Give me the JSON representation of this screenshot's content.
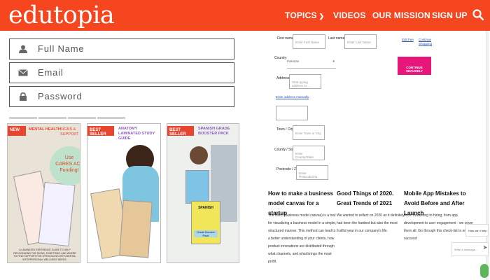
{
  "header": {
    "logo": "edutopia",
    "nav": [
      {
        "label": "TOPICS"
      },
      {
        "label": "VIDEOS"
      },
      {
        "label": "OUR MISSION"
      },
      {
        "label": "SIGN UP"
      }
    ],
    "bg_color": "#f5461f"
  },
  "signup_form": {
    "full_name": "Full Name",
    "email": "Email",
    "password": "Password"
  },
  "books": [
    {
      "badge": "NEW",
      "title": "MENTAL HEALTH",
      "subtitle": "SIGNS & SUPPORT",
      "promo_line1": "Use",
      "promo_line2": "CARES ACT",
      "promo_line3": "Funding!",
      "footer": "A LAMINATED REFERENCE GUIDE TO HELP RECOGNIZING THE SIGNS, SYMPTOMS, AND WHERE TO FIND SUPPORT FOR STRUGGLING WITH MENTAL INTERPERSONAL WELLNESS NEEDS."
    },
    {
      "badge": "BEST SELLER",
      "title": "ANATOMY LAMINATED STUDY GUIDE"
    },
    {
      "badge": "BEST SELLER",
      "title": "SPANISH GRADE BOOSTER PACK",
      "cover_tag": "SPANISH",
      "cover_guide": "Grade Booster Pack"
    }
  ],
  "checkout": {
    "first_name_label": "First name *",
    "first_name_placeholder": "Enter First Name",
    "last_name_label": "Last name *",
    "last_name_placeholder": "Enter Last Name",
    "edit_fee": "Edit Fee",
    "continue_shopping": "Continue Shopping",
    "continue_button": "CONTINUE SECURELY",
    "country_label": "Country",
    "country_value": "Pakistan",
    "address_label": "Address *",
    "address_placeholder": "Start typing address to ...",
    "manual_address_link": "Enter address manually",
    "town_label": "Town / City *",
    "town_placeholder": "Enter Town or City",
    "county_label": "County / State",
    "county_placeholder": "Enter County/State",
    "postcode_label": "Postcode / Zip *",
    "postcode_placeholder": "Enter Postcode/Zip"
  },
  "articles": [
    {
      "title": "How to make a business model canvas for a startup",
      "body": "The BMC (business model canvas) is a tool for visualizing a business model in a simple, structured manner. This method can lead to a better understanding of your clients, how product innovations are distributed through what channels, and what brings the most profit."
    },
    {
      "title": "Good Things of 2020. Great Trends of 2021",
      "body": "We wanted to reflect on 2020 as it definitely had been the hardest but also the most fruitful year in our company's life."
    },
    {
      "title": "Mobile App Mistakes to Avoid Before and After Launch",
      "body": "From marketing to hiring, from app development to user engagement - we cover them all. Go through this check-list to ensure success!"
    }
  ],
  "chat": {
    "question": "How can I help you?",
    "input_placeholder": "Write a message..."
  },
  "icons": {
    "search": "search-icon",
    "user": "user-icon",
    "email": "envelope-icon",
    "password": "lock-icon",
    "send": "send-icon",
    "chat": "chat-bubble-icon"
  }
}
